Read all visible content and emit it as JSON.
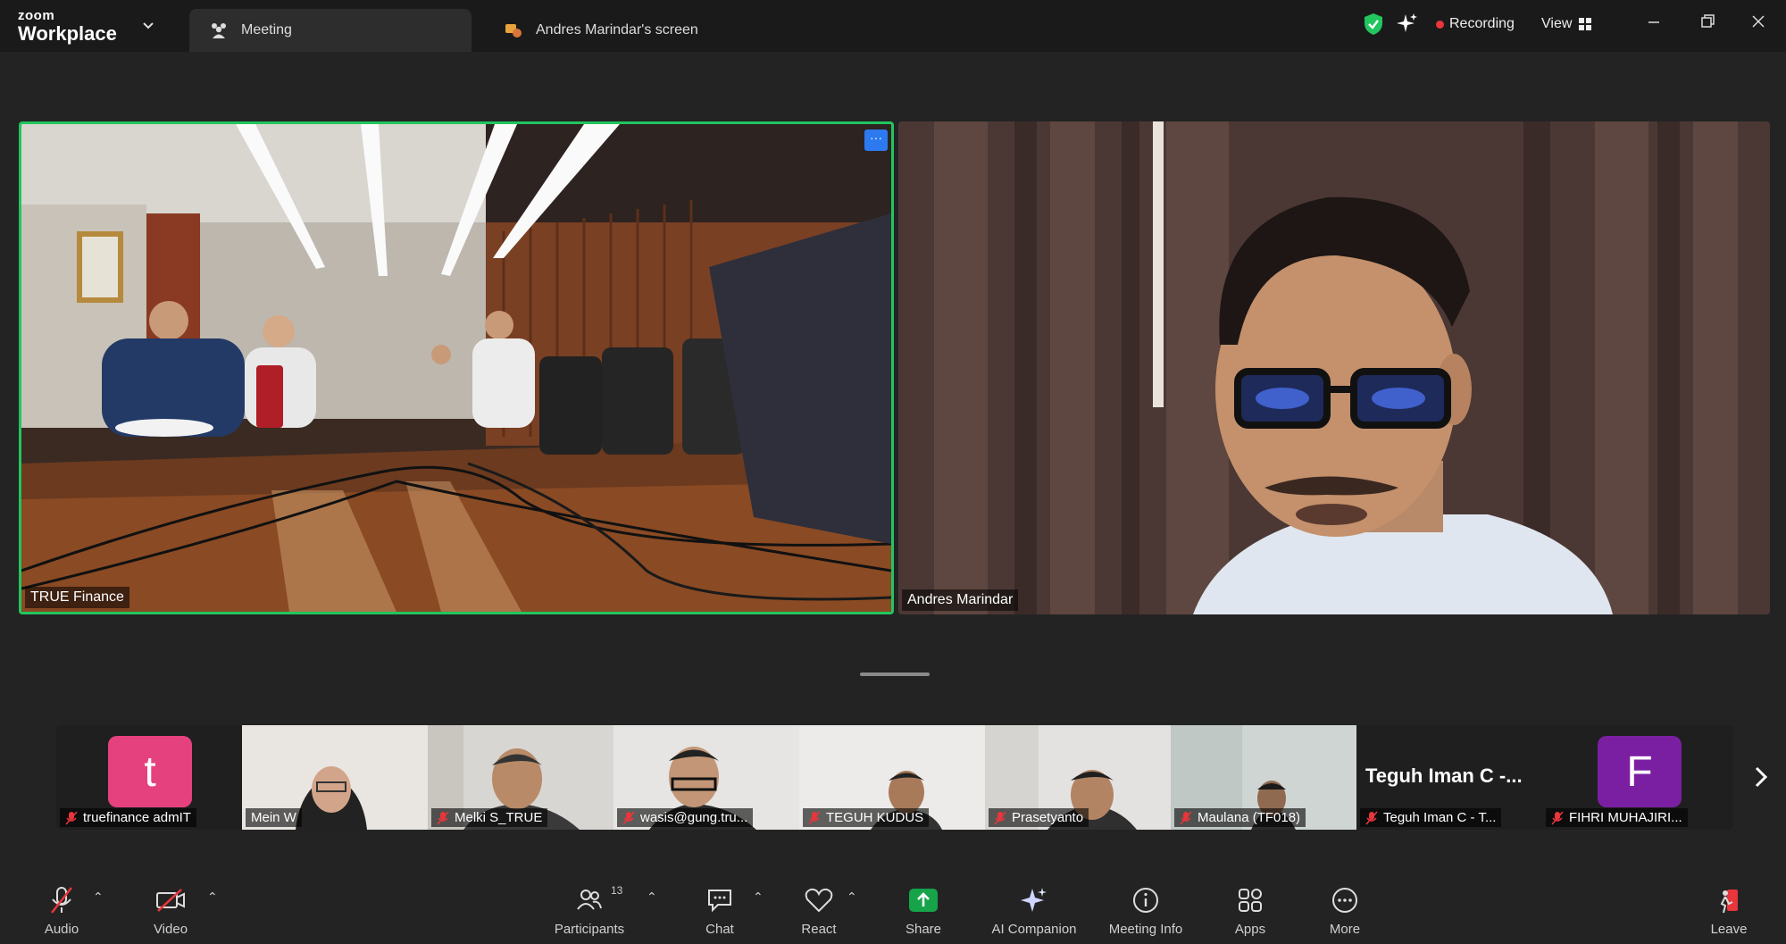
{
  "app": {
    "brand_small": "zoom",
    "brand_large": "Workplace"
  },
  "tabs": [
    {
      "label": "Meeting",
      "icon": "meeting-icon",
      "active": true
    },
    {
      "label": "Andres Marindar's screen",
      "icon": "share-screen-icon",
      "active": false
    }
  ],
  "topbar": {
    "recording_label": "Recording",
    "view_label": "View"
  },
  "tiles": {
    "left_name": "TRUE Finance",
    "right_name": "Andres Marindar"
  },
  "participants": [
    {
      "name": "truefinance admIT",
      "avatar_letter": "t",
      "avatar_color": "#e6417f",
      "muted": true
    },
    {
      "name": "Mein W",
      "muted": false
    },
    {
      "name": "Melki S_TRUE",
      "muted": true
    },
    {
      "name": "wasis@gung.tru...",
      "muted": true
    },
    {
      "name": "TEGUH KUDUS",
      "muted": true
    },
    {
      "name": "Prasetyanto",
      "muted": true
    },
    {
      "name": "Maulana (TF018)",
      "muted": true
    },
    {
      "name": "Teguh Iman C - T...",
      "display_title": "Teguh Iman C -...",
      "muted": true
    },
    {
      "name": "FIHRI MUHAJIRI...",
      "avatar_letter": "F",
      "avatar_color": "#7b1fa2",
      "muted": true
    }
  ],
  "toolbar": {
    "audio": "Audio",
    "video": "Video",
    "participants": "Participants",
    "participants_count": "13",
    "chat": "Chat",
    "react": "React",
    "share": "Share",
    "ai_companion": "AI Companion",
    "meeting_info": "Meeting Info",
    "apps": "Apps",
    "more": "More",
    "leave": "Leave"
  },
  "colors": {
    "accent_green": "#22c55e",
    "share_green": "#16a34a",
    "recording_red": "#e8363c",
    "mute_red": "#e8363c"
  }
}
